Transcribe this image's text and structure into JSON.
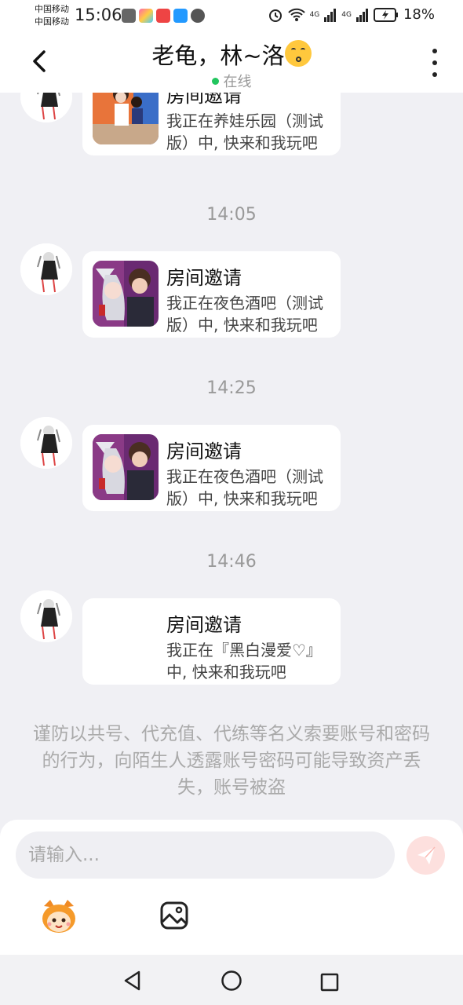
{
  "status_bar": {
    "carrier_1": "中国移动",
    "carrier_2": "中国移动",
    "time": "15:06",
    "network_1": "4G",
    "network_2": "4G",
    "battery": "18%"
  },
  "header": {
    "back_icon": "chevron-left-icon",
    "title": "老龟，林~洛",
    "status": "在线",
    "status_color": "#22c55e",
    "more_icon": "more-vertical-icon"
  },
  "messages": [
    {
      "card_title": "房间邀请",
      "card_text": "我正在养娃乐园（测试版）中, 快来和我玩吧",
      "thumb": "game-thumbnail-kids"
    },
    {
      "time": "14:05",
      "card_title": "房间邀请",
      "card_text": "我正在夜色酒吧（测试版）中, 快来和我玩吧",
      "thumb": "game-thumbnail-bar"
    },
    {
      "time": "14:25",
      "card_title": "房间邀请",
      "card_text": "我正在夜色酒吧（测试版）中, 快来和我玩吧",
      "thumb": "game-thumbnail-bar"
    },
    {
      "time": "14:46",
      "card_title": "房间邀请",
      "card_text": "我正在『黑白漫爱♡』中, 快来和我玩吧",
      "thumb": "none"
    }
  ],
  "warning": "谨防以共号、代充值、代练等名义索要账号和密码的行为，向陌生人透露账号密码可能导致资产丢失，账号被盗",
  "input": {
    "placeholder": "请输入...",
    "send_icon": "send-icon",
    "send_color": "#fde0de"
  },
  "toolbar": {
    "mascot_icon": "mascot-emoji-icon",
    "image_icon": "image-icon"
  },
  "nav": {
    "back_icon": "nav-back-icon",
    "home_icon": "nav-home-icon",
    "recent_icon": "nav-recent-icon"
  }
}
